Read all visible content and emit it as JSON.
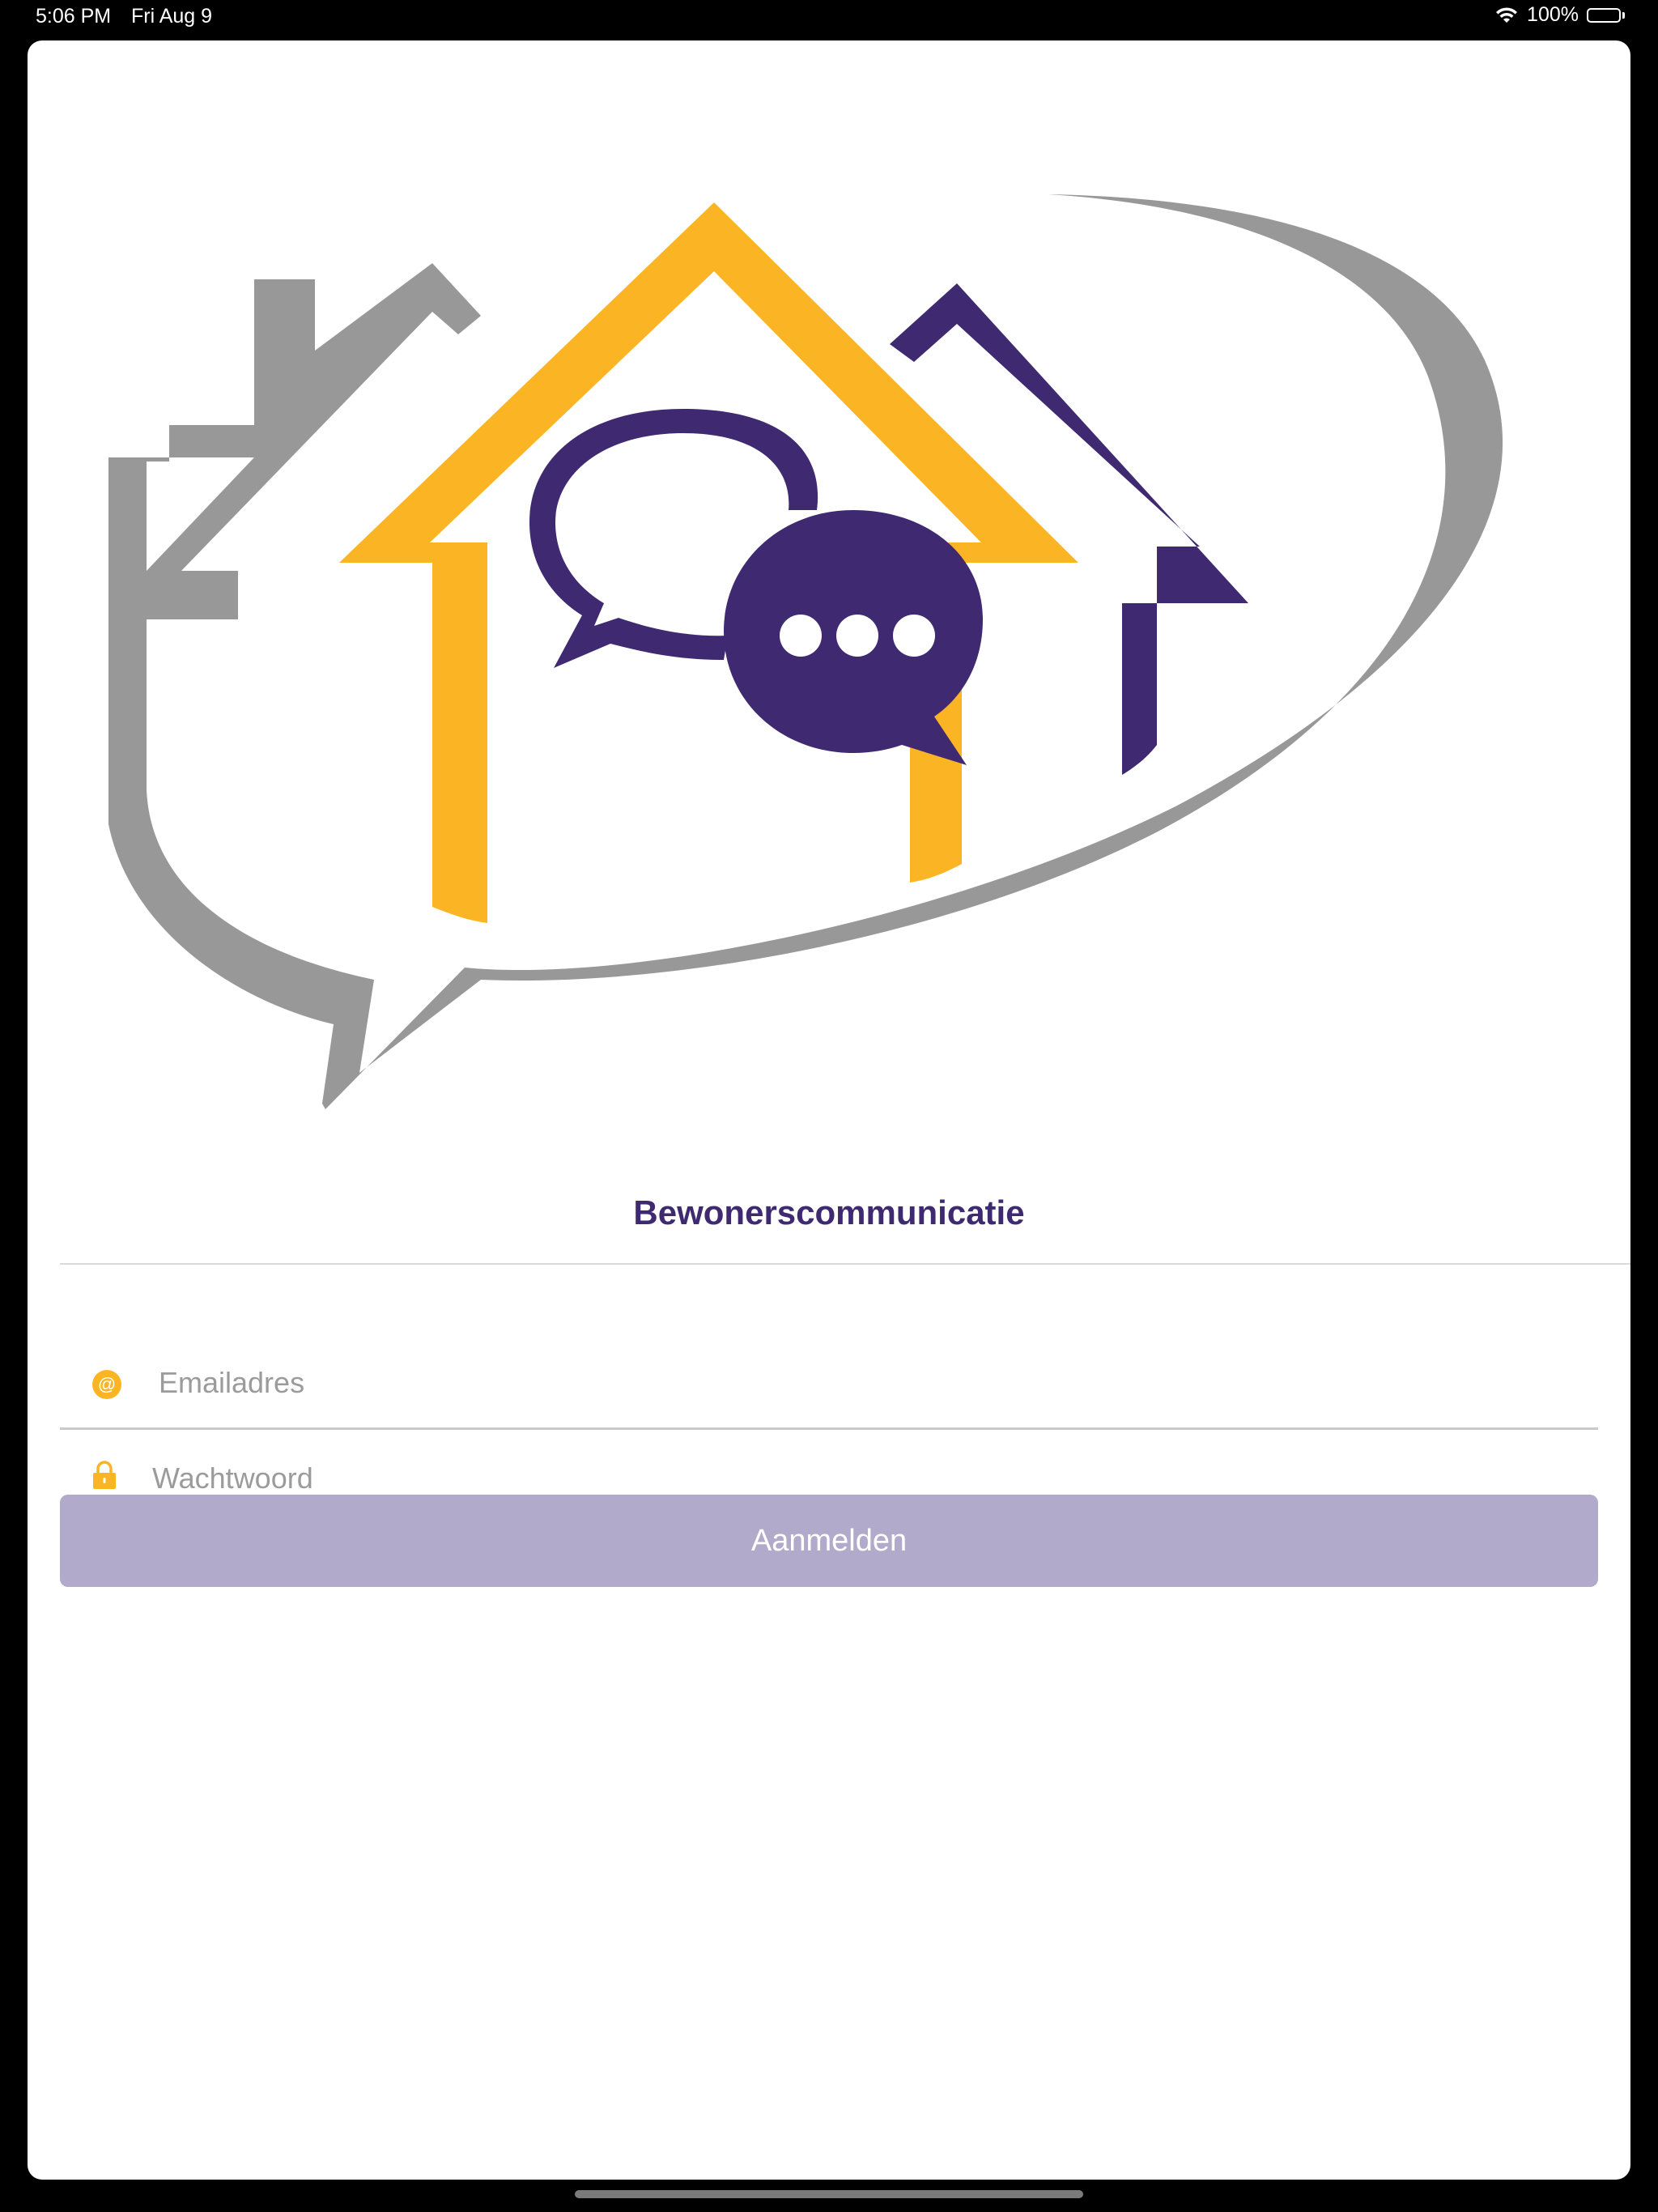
{
  "status_bar": {
    "time": "5:06 PM",
    "date": "Fri Aug 9",
    "battery": "100%",
    "wifi_icon": "wifi-icon",
    "battery_icon": "battery-icon"
  },
  "app": {
    "title": "Bewonerscommunicatie",
    "logo_icon": "house-chat-logo"
  },
  "form": {
    "email": {
      "icon": "at-sign-icon",
      "placeholder": "Emailadres",
      "value": ""
    },
    "password": {
      "icon": "lock-icon",
      "placeholder": "Wachtwoord",
      "value": ""
    },
    "submit_label": "Aanmelden"
  },
  "colors": {
    "brand_purple": "#3f2a72",
    "brand_yellow": "#fbb524",
    "brand_gray": "#989898",
    "button_disabled": "#b2aaca"
  }
}
